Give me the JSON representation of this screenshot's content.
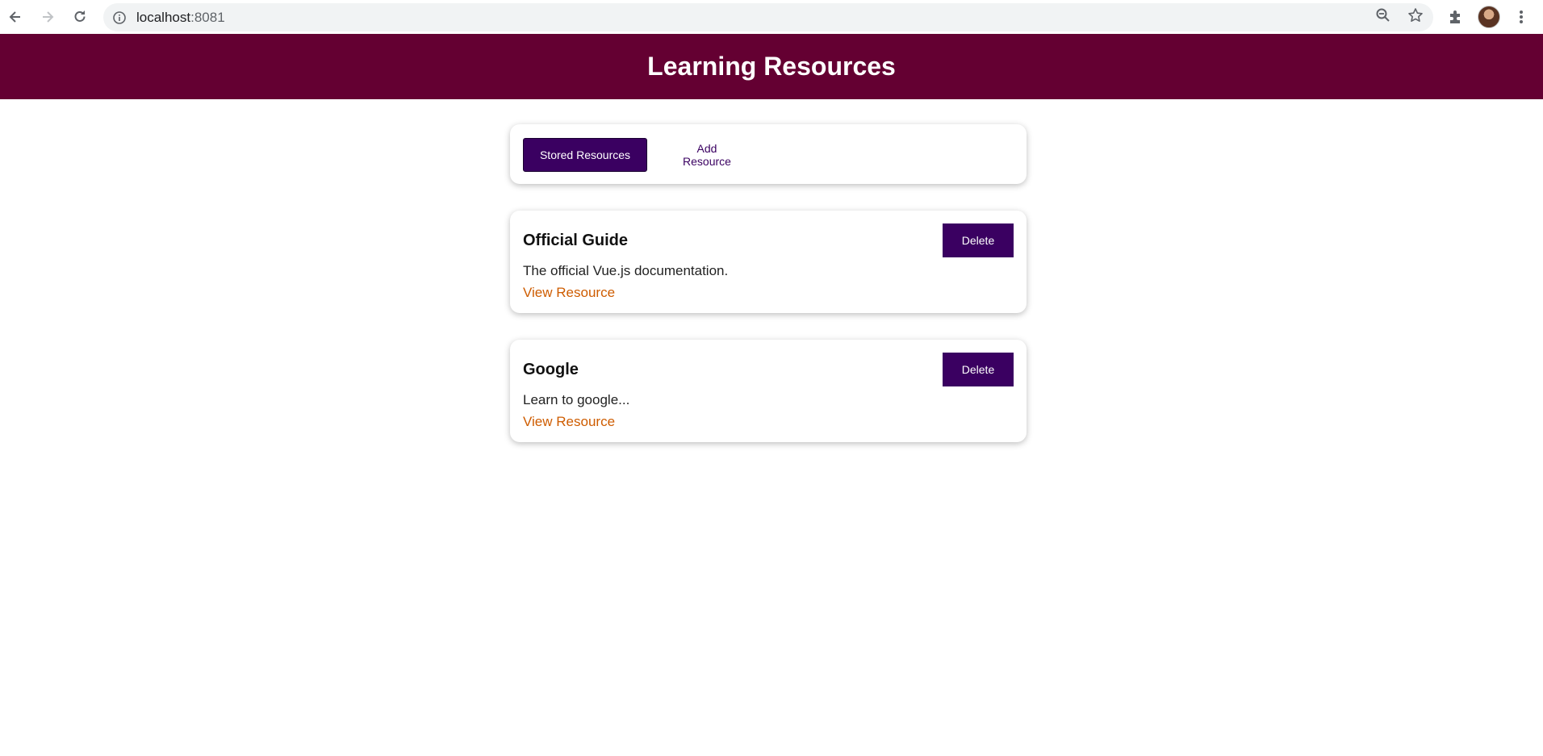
{
  "browser": {
    "url_host": "localhost",
    "url_port": ":8081"
  },
  "page": {
    "title": "Learning Resources"
  },
  "tabs": {
    "stored_label": "Stored Resources",
    "add_label": "Add Resource"
  },
  "resources": [
    {
      "title": "Official Guide",
      "description": "The official Vue.js documentation.",
      "link_label": "View Resource",
      "delete_label": "Delete"
    },
    {
      "title": "Google",
      "description": "Learn to google...",
      "link_label": "View Resource",
      "delete_label": "Delete"
    }
  ],
  "colors": {
    "header_bg": "#640032",
    "primary": "#3a0061",
    "link": "#ce5c00"
  },
  "icons": {
    "back": "back-arrow-icon",
    "forward": "forward-arrow-icon",
    "reload": "reload-icon",
    "info": "info-icon",
    "zoom": "zoom-out-icon",
    "bookmark": "star-icon",
    "extensions": "puzzle-icon",
    "menu": "kebab-menu-icon"
  }
}
